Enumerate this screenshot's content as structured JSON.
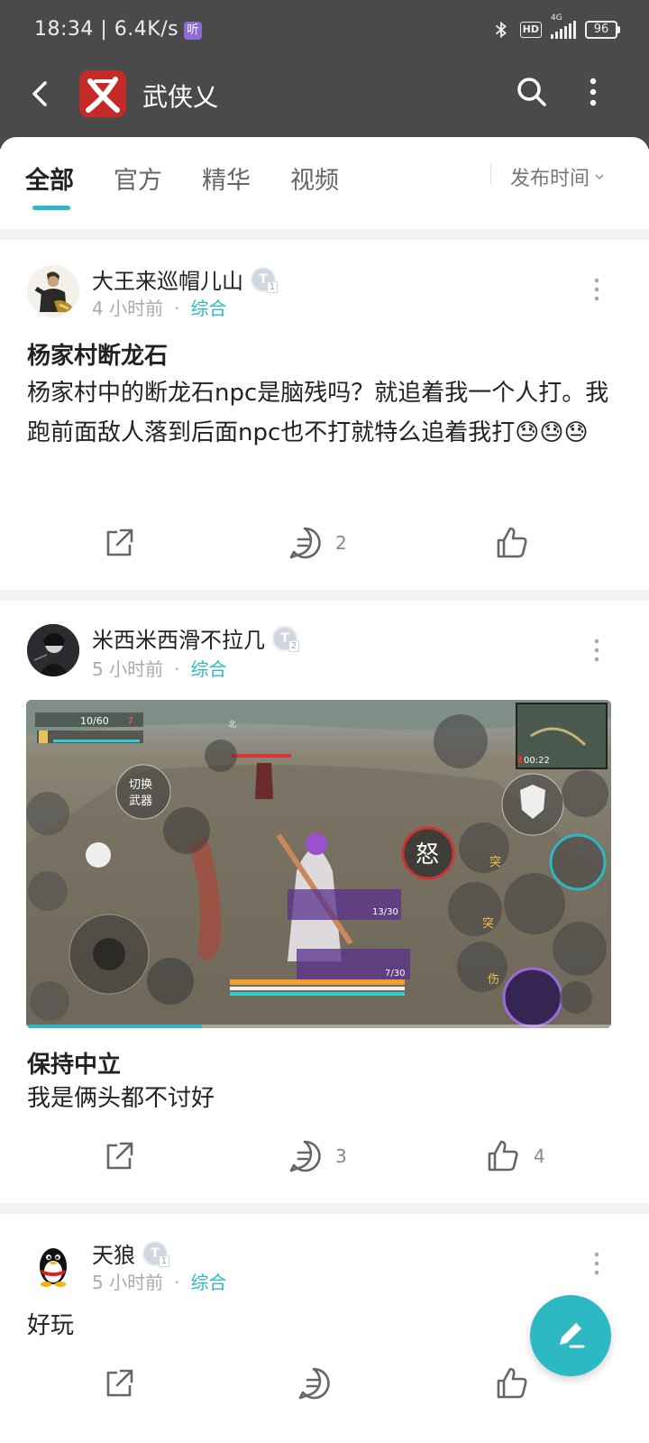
{
  "status_bar": {
    "time": "18:34 | 6.4K/s",
    "ting_badge": "听",
    "hd": "HD",
    "network": "4G",
    "battery": "96"
  },
  "header": {
    "title": "武侠乂",
    "logo_char": "乂"
  },
  "tabs": {
    "items": [
      {
        "label": "全部"
      },
      {
        "label": "官方"
      },
      {
        "label": "精华"
      },
      {
        "label": "视频"
      }
    ],
    "sort_label": "发布时间"
  },
  "posts": [
    {
      "author": "大王来巡帽儿山",
      "level": "T",
      "level_num": "1",
      "time": "4 小时前",
      "category": "综合",
      "title": "杨家村断龙石",
      "body": "杨家村中的断龙石npc是脑残吗？就追着我一个人打。我跑前面敌人落到后面npc也不打就特么追着我打😓😓😓",
      "comments": "2",
      "likes": ""
    },
    {
      "author": "米西米西滑不拉几",
      "level": "T",
      "level_num": "2",
      "time": "5 小时前",
      "category": "综合",
      "title": "保持中立",
      "body": "我是俩头都不讨好",
      "comments": "3",
      "likes": "4",
      "video_progress": 0.3,
      "game_hud": {
        "switch_weapon": "切换\n武器",
        "rage": "怒",
        "tu": "突",
        "shang": "伤",
        "ammo1": "13/30",
        "ammo2": "7/30",
        "timer": "00:22",
        "hp": "10/60",
        "kills": "7",
        "north": "北"
      }
    },
    {
      "author": "天狼",
      "level": "T",
      "level_num": "1",
      "time": "5 小时前",
      "category": "综合",
      "title": "",
      "body": "好玩",
      "comments": "",
      "likes": ""
    }
  ],
  "colors": {
    "accent": "#2cb9c4",
    "header_bg": "#4a4a4a",
    "logo_red": "#c42b26"
  }
}
